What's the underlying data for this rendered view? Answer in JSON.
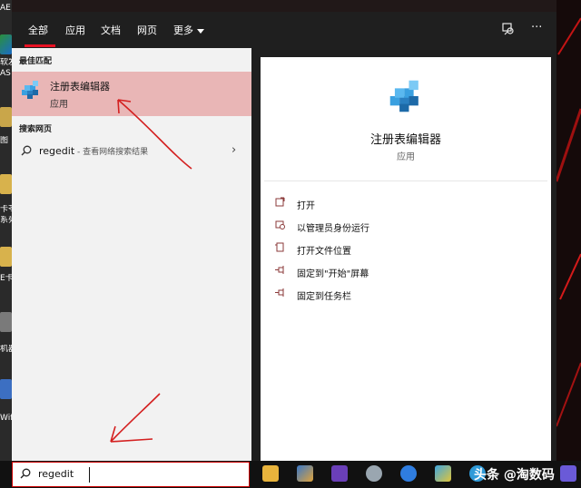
{
  "tabs": [
    {
      "label": "全部",
      "active": true
    },
    {
      "label": "应用"
    },
    {
      "label": "文档"
    },
    {
      "label": "网页"
    },
    {
      "label": "更多"
    }
  ],
  "top_icons": [
    "feedback-icon",
    "more-options-icon"
  ],
  "best_match": {
    "heading": "最佳匹配",
    "title": "注册表编辑器",
    "subtitle": "应用",
    "icon": "regedit-icon"
  },
  "web_search": {
    "heading": "搜索网页",
    "query": "regedit",
    "suffix": " - 查看网络搜索结果",
    "icon": "search-icon"
  },
  "detail": {
    "title": "注册表编辑器",
    "subtitle": "应用",
    "actions": [
      {
        "label": "打开",
        "icon": "open-icon"
      },
      {
        "label": "以管理员身份运行",
        "icon": "admin-shield-icon"
      },
      {
        "label": "打开文件位置",
        "icon": "file-location-icon"
      },
      {
        "label": "固定到\"开始\"屏幕",
        "icon": "pin-icon"
      },
      {
        "label": "固定到任务栏",
        "icon": "pin-icon"
      }
    ]
  },
  "search_box": {
    "value": "regedit",
    "icon": "search-icon"
  },
  "desktop_left_text": [
    "AE",
    "软发",
    "AS",
    "图",
    "卡苓",
    "系列",
    "E卡",
    "机器",
    "Wifi"
  ],
  "watermark": "头条 @淘数码",
  "colors": {
    "accent": "#e81123",
    "highlight": "#e9b6b6",
    "annotation": "#d42020"
  }
}
